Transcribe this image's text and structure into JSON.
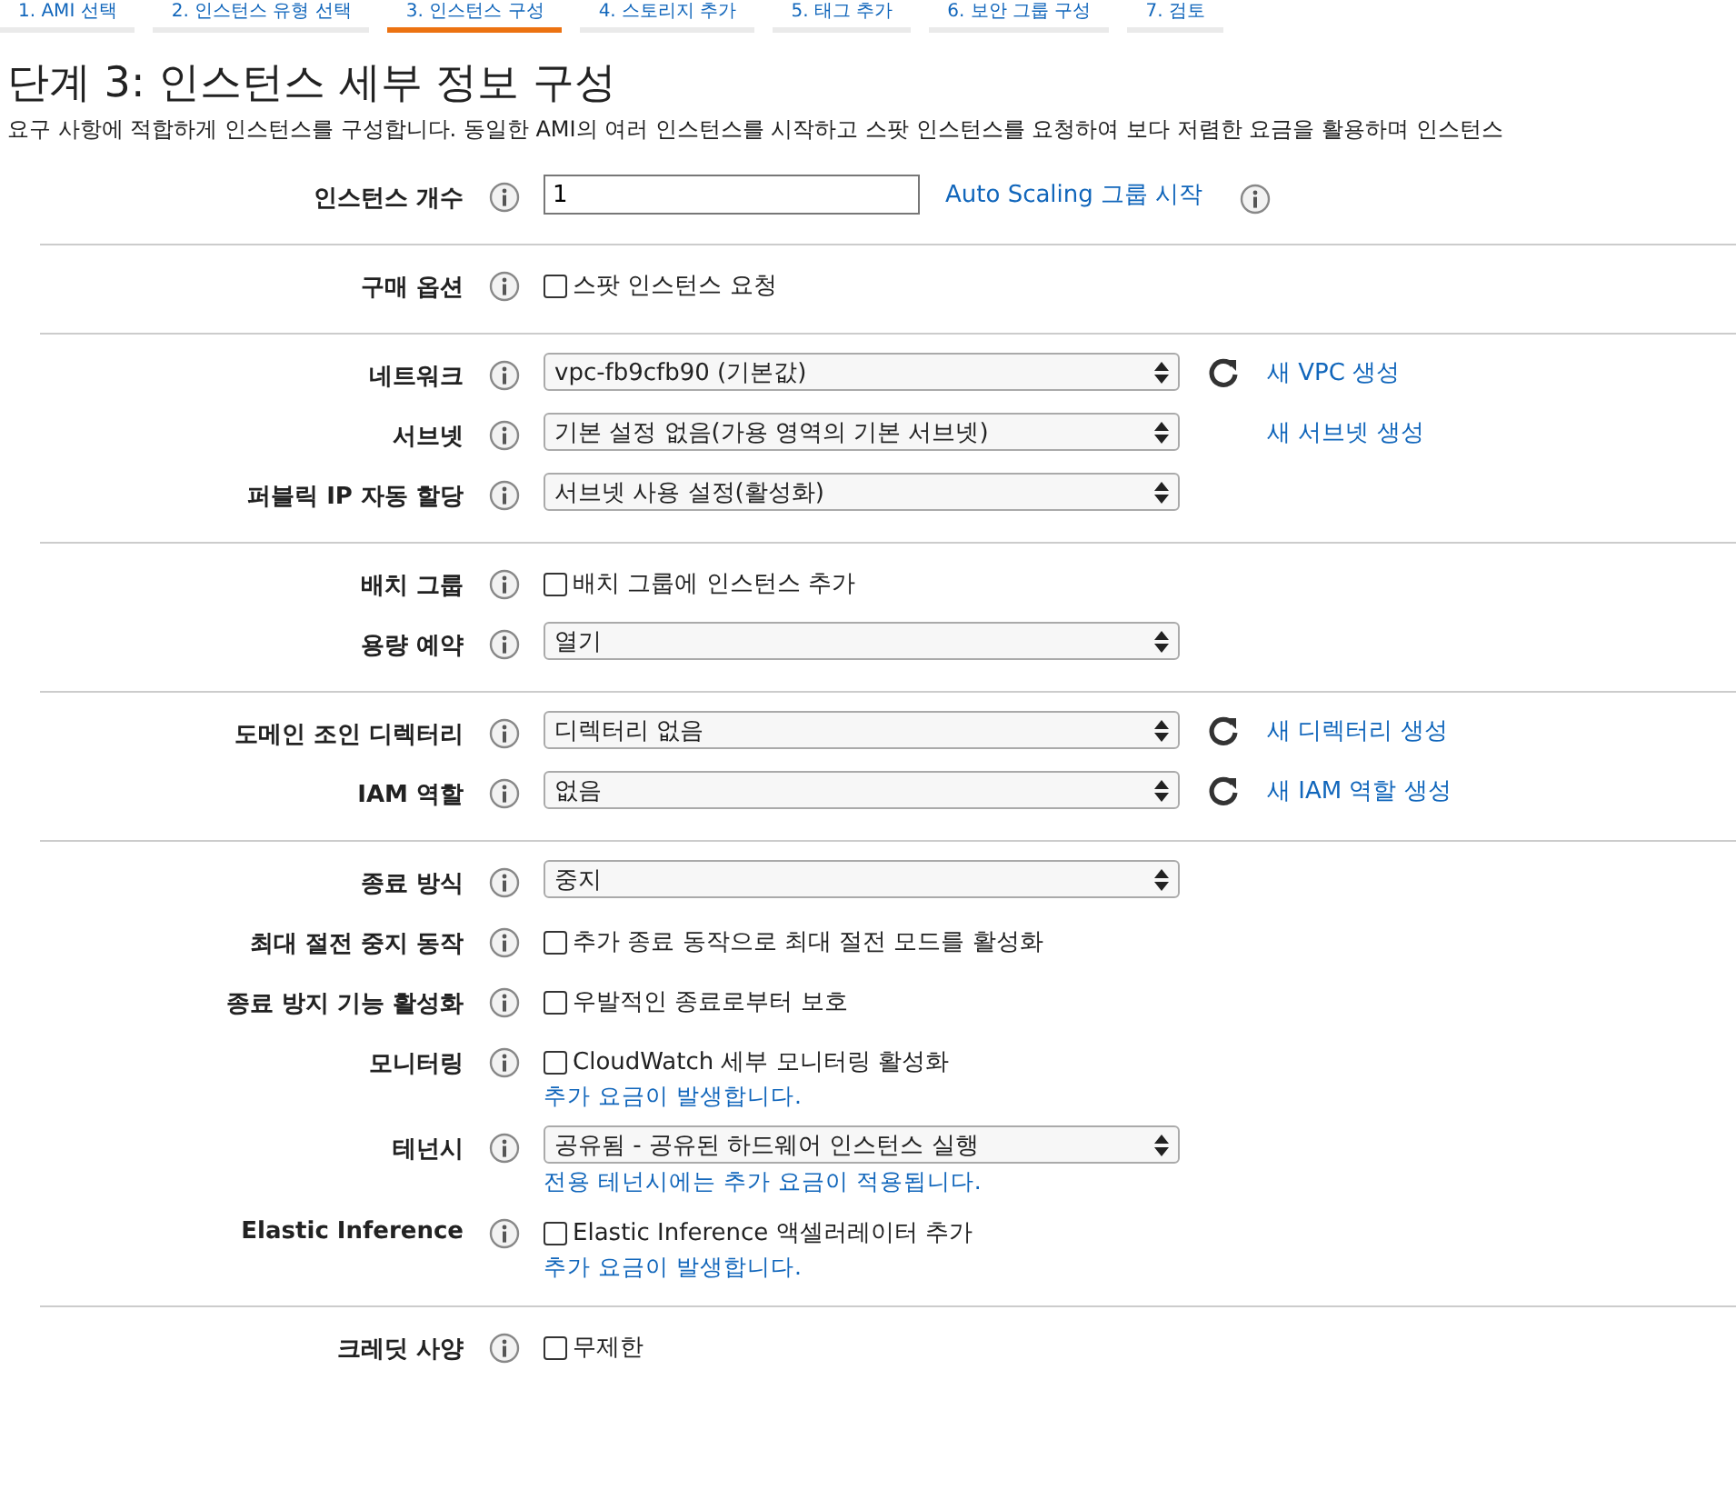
{
  "steps": [
    {
      "label": "1. AMI 선택",
      "selected": false
    },
    {
      "label": "2. 인스턴스 유형 선택",
      "selected": false
    },
    {
      "label": "3. 인스턴스 구성",
      "selected": true
    },
    {
      "label": "4. 스토리지 추가",
      "selected": false
    },
    {
      "label": "5. 태그 추가",
      "selected": false
    },
    {
      "label": "6. 보안 그룹 구성",
      "selected": false
    },
    {
      "label": "7. 검토",
      "selected": false
    }
  ],
  "title": "단계 3: 인스턴스 세부 정보 구성",
  "description": "요구 사항에 적합하게 인스턴스를 구성합니다. 동일한 AMI의 여러 인스턴스를 시작하고 스팟 인스턴스를 요청하여 보다 저렴한 요금을 활용하며 인스턴스",
  "sections": [
    [
      {
        "label": "인스턴스 개수",
        "kind": "input",
        "value": "1",
        "link": {
          "text": "Auto Scaling 그룹 시작",
          "refresh": false,
          "info": true
        }
      }
    ],
    [
      {
        "label": "구매 옵션",
        "kind": "checkbox",
        "value": "스팟 인스턴스 요청",
        "checked": false
      }
    ],
    [
      {
        "label": "네트워크",
        "kind": "select",
        "value": "vpc-fb9cfb90 (기본값)",
        "link": {
          "text": "새 VPC 생성",
          "refresh": true,
          "info": false
        }
      },
      {
        "label": "서브넷",
        "kind": "select",
        "value": "기본 설정 없음(가용 영역의 기본 서브넷)",
        "link": {
          "text": "새 서브넷 생성",
          "refresh": false,
          "info": false
        }
      },
      {
        "label": "퍼블릭 IP 자동 할당",
        "kind": "select",
        "value": "서브넷 사용 설정(활성화)"
      }
    ],
    [
      {
        "label": "배치 그룹",
        "kind": "checkbox",
        "value": "배치 그룹에 인스턴스 추가",
        "checked": false
      },
      {
        "label": "용량 예약",
        "kind": "select",
        "value": "열기"
      }
    ],
    [
      {
        "label": "도메인 조인 디렉터리",
        "kind": "select",
        "value": "디렉터리 없음",
        "link": {
          "text": "새 디렉터리 생성",
          "refresh": true,
          "info": false
        }
      },
      {
        "label": "IAM 역할",
        "kind": "select",
        "value": "없음",
        "link": {
          "text": "새 IAM 역할 생성",
          "refresh": true,
          "info": false
        }
      }
    ],
    [
      {
        "label": "종료 방식",
        "kind": "select",
        "value": "중지"
      },
      {
        "label": "최대 절전 중지 동작",
        "kind": "checkbox",
        "value": "추가 종료 동작으로 최대 절전 모드를 활성화",
        "checked": false
      },
      {
        "label": "종료 방지 기능 활성화",
        "kind": "checkbox",
        "value": "우발적인 종료로부터 보호",
        "checked": false
      },
      {
        "label": "모니터링",
        "kind": "checkbox",
        "value": "CloudWatch 세부 모니터링 활성화",
        "checked": false,
        "note": "추가 요금이 발생합니다."
      },
      {
        "label": "테넌시",
        "kind": "select",
        "value": "공유됨 - 공유된 하드웨어 인스턴스 실행",
        "note": "전용 테넌시에는 추가 요금이 적용됩니다."
      },
      {
        "label": "Elastic Inference",
        "kind": "checkbox",
        "value": "Elastic Inference 액셀러레이터 추가",
        "checked": false,
        "note": "추가 요금이 발생합니다."
      }
    ],
    [
      {
        "label": "크레딧 사양",
        "kind": "checkbox",
        "value": "무제한",
        "checked": false
      }
    ]
  ]
}
